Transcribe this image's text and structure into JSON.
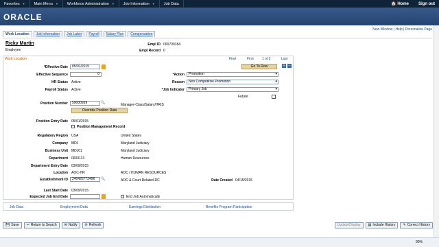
{
  "menubar": {
    "items": [
      "Favorites",
      "Main Menu",
      "Workforce Administration",
      "Job Information",
      "Job Data"
    ],
    "home": "Home",
    "signout": "Sign out"
  },
  "brand": "ORACLE",
  "tabs": [
    "Work Location",
    "Job Information",
    "Job Labor",
    "Payroll",
    "Salary Plan",
    "Compensation"
  ],
  "tablinks": "New Window | Help | Personalize Page",
  "employee": {
    "name": "Ricky Martin",
    "type": "Employee",
    "empl_id_label": "Empl ID",
    "empl_id": "000700184",
    "empl_record_label": "Empl Record",
    "empl_record": "0"
  },
  "worklocation": {
    "title": "Work Location",
    "find": "Find",
    "first": "First",
    "nav": "1 of 2",
    "last": "Last",
    "goto": "Go To Row"
  },
  "fields": {
    "effective_date_label": "*Effective Date",
    "effective_date": "05/01/2015",
    "effective_seq_label": "Effective Sequence",
    "effective_seq": "0",
    "action_label": "*Action",
    "action": "Promotion",
    "hr_status_label": "HR Status",
    "hr_status": "Active",
    "reason_label": "Reason",
    "reason": "Non Competitive Promotion",
    "payroll_status_label": "Payroll Status",
    "payroll_status": "Active",
    "job_indicator_label": "*Job Indicator",
    "job_indicator": "Primary Job",
    "future": "Future",
    "position_number_label": "Position Number",
    "position_number": "59000939",
    "position_desc": "Manager-Class/Salary/HRIS",
    "override": "Override Position Data",
    "position_entry_label": "Position Entry Date",
    "position_entry": "05/01/2015",
    "pos_mgmt": "Position Management Record",
    "reg_region_label": "Regulatory Region",
    "reg_region": "USA",
    "reg_region_desc": "United States",
    "company_label": "Company",
    "company": "MDJ",
    "company_desc": "Maryland Judiciary",
    "bu_label": "Business Unit",
    "bu": "MDJ01",
    "bu_desc": "Maryland Judiciary",
    "dept_label": "Department",
    "dept": "0600113",
    "dept_desc": "Human Resources",
    "dept_entry_label": "Department Entry Date",
    "dept_entry": "03/09/2015",
    "location_label": "Location",
    "location": "AOC-HR",
    "location_desc": "AOC / HUMAN RESOURCES",
    "estab_label": "Establishment ID",
    "estab": "240425772496",
    "estab_desc": "AOC & Court Related-DC",
    "date_created_label": "Date Created",
    "date_created": "04/15/2015",
    "last_start_label": "Last Start Date",
    "last_start": "03/09/2015",
    "exp_end_label": "Expected Job End Date",
    "end_job": "End Job Automatically"
  },
  "links": [
    "Job Data",
    "Employment Data",
    "Earnings Distribution",
    "Benefits Program Participation"
  ],
  "bottom": {
    "save": "Save",
    "return": "Return to Search",
    "notify": "Notify",
    "refresh": "Refresh",
    "update": "Update/Display",
    "history": "Include History",
    "correct": "Correct History"
  },
  "status": {
    "zoom": "90%"
  }
}
